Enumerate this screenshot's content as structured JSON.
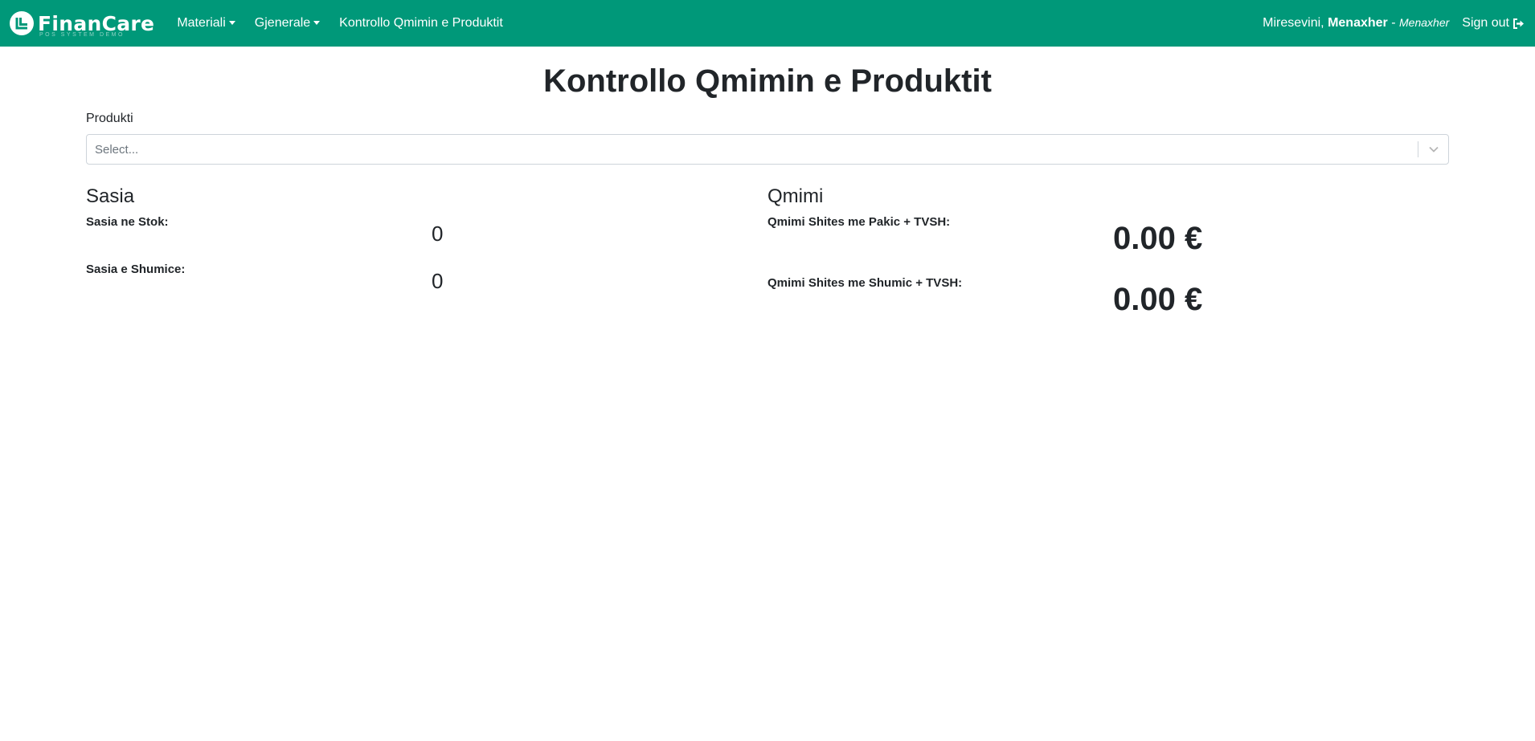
{
  "app": {
    "brand": "FinanCare",
    "brand_tagline": "POS SYSTEM DEMO",
    "brand_color": "#009879"
  },
  "nav": {
    "items": [
      {
        "label": "Materiali",
        "dropdown": true
      },
      {
        "label": "Gjenerale",
        "dropdown": true
      },
      {
        "label": "Kontrollo Qmimin e Produktit",
        "dropdown": false
      }
    ],
    "welcome_prefix": "Miresevini,",
    "user_name": "Menaxher",
    "user_separator": "-",
    "user_role": "Menaxher",
    "signout_label": "Sign out",
    "signout_icon": "sign-out-icon"
  },
  "page": {
    "title": "Kontrollo Qmimin e Produktit",
    "product_label": "Produkti",
    "product_select": {
      "placeholder": "Select...",
      "icon": "chevron-down-icon"
    }
  },
  "quantity": {
    "heading": "Sasia",
    "stock_label": "Sasia ne Stok:",
    "stock_value": "0",
    "wholesale_label": "Sasia e Shumice:",
    "wholesale_value": "0"
  },
  "price": {
    "heading": "Qmimi",
    "retail_label": "Qmimi Shites me Pakic + TVSH:",
    "retail_value": "0.00 €",
    "wholesale_label": "Qmimi Shites me Shumic + TVSH:",
    "wholesale_value": "0.00 €"
  }
}
